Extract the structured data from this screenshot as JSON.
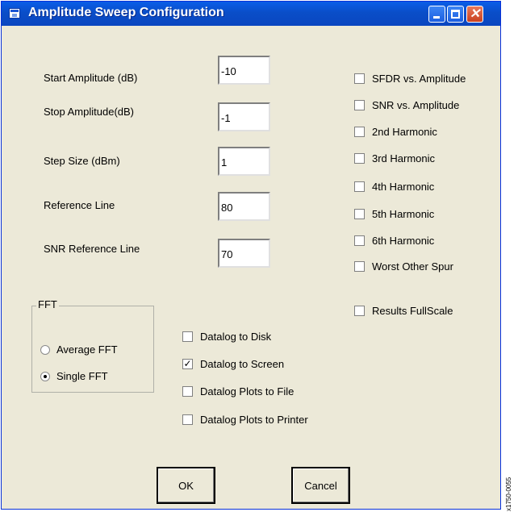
{
  "window": {
    "title": "Amplitude Sweep Configuration",
    "controls": {
      "minimize": "minimize",
      "maximize": "maximize",
      "close": "✕"
    }
  },
  "fields": [
    {
      "label": "Start Amplitude (dB)",
      "value": "-10"
    },
    {
      "label": "Stop Amplitude(dB)",
      "value": "-1"
    },
    {
      "label": "Step Size (dBm)",
      "value": "1"
    },
    {
      "label": "Reference Line",
      "value": "80"
    },
    {
      "label": "SNR Reference Line",
      "value": "70"
    }
  ],
  "right_checks": [
    {
      "label": "SFDR vs. Amplitude",
      "checked": false
    },
    {
      "label": "SNR vs. Amplitude",
      "checked": false
    },
    {
      "label": "2nd Harmonic",
      "checked": false
    },
    {
      "label": "3rd Harmonic",
      "checked": false
    },
    {
      "label": "4th Harmonic",
      "checked": false
    },
    {
      "label": "5th Harmonic",
      "checked": false
    },
    {
      "label": "6th Harmonic",
      "checked": false
    },
    {
      "label": "Worst Other Spur",
      "checked": false
    },
    {
      "label": "Results FullScale",
      "checked": false
    }
  ],
  "fft": {
    "title": "FFT",
    "options": [
      {
        "label": "Average FFT",
        "selected": false
      },
      {
        "label": "Single FFT",
        "selected": true
      }
    ]
  },
  "datalog": [
    {
      "label": "Datalog to Disk",
      "checked": false
    },
    {
      "label": "Datalog to Screen",
      "checked": true
    },
    {
      "label": "Datalog Plots to File",
      "checked": false
    },
    {
      "label": "Datalog Plots to Printer",
      "checked": false
    }
  ],
  "buttons": {
    "ok": "OK",
    "cancel": "Cancel"
  },
  "figure_code": "x1750-0055",
  "icons": {
    "check": "✓"
  }
}
